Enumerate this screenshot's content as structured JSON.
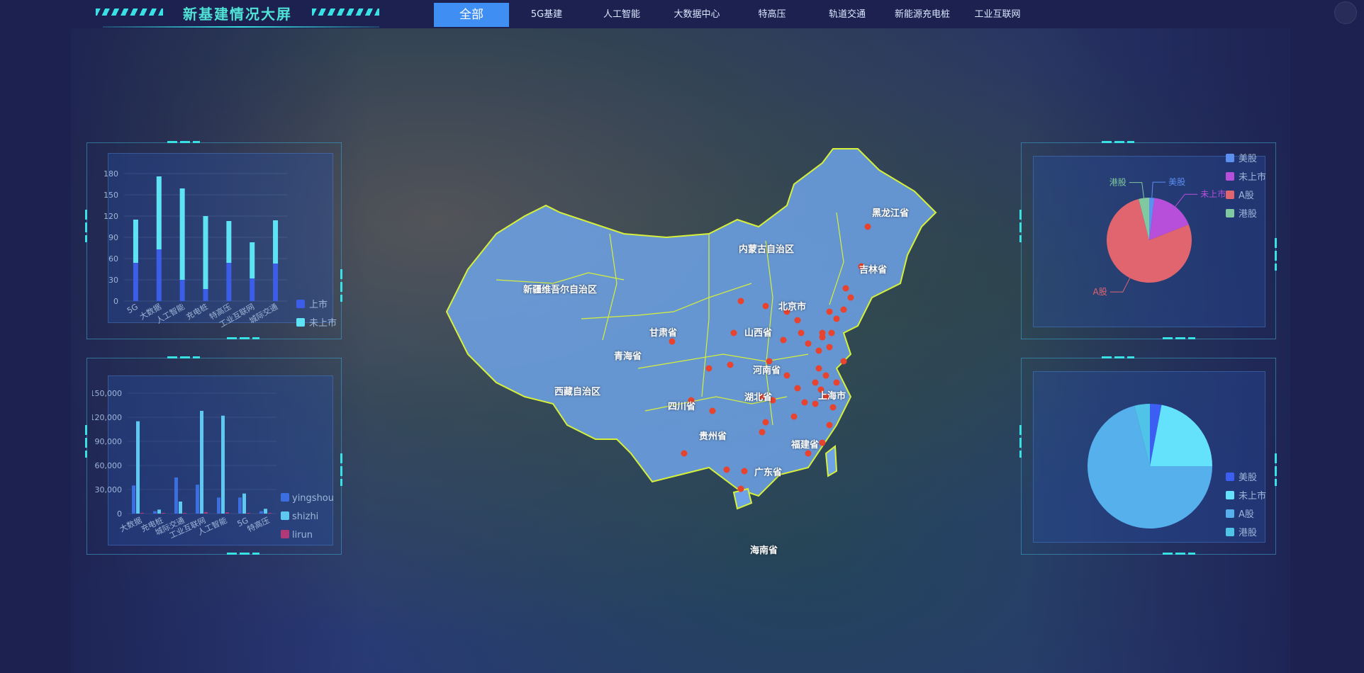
{
  "header": {
    "title": "新基建情况大屏",
    "tabs": [
      "全部",
      "5G基建",
      "人工智能",
      "大数据中心",
      "特高压",
      "轨道交通",
      "新能源充电桩",
      "工业互联网"
    ],
    "active_tab": "全部"
  },
  "map": {
    "provinces": [
      {
        "name": "黑龙江省"
      },
      {
        "name": "内蒙古自治区"
      },
      {
        "name": "吉林省"
      },
      {
        "name": "新疆维吾尔自治区"
      },
      {
        "name": "北京市"
      },
      {
        "name": "甘肃省"
      },
      {
        "name": "山西省"
      },
      {
        "name": "青海省"
      },
      {
        "name": "河南省"
      },
      {
        "name": "西藏自治区"
      },
      {
        "name": "湖北省"
      },
      {
        "name": "上海市"
      },
      {
        "name": "四川省"
      },
      {
        "name": "贵州省"
      },
      {
        "name": "福建省"
      },
      {
        "name": "广东省"
      },
      {
        "name": "海南省"
      }
    ],
    "marker_color": "#e8432e",
    "province_color": "#6ea3e8",
    "border_color": "#d6f03a"
  },
  "chart_data": [
    {
      "id": "listed-by-sector",
      "type": "bar",
      "stacked": true,
      "categories": [
        "5G",
        "大数据",
        "人工智能",
        "充电桩",
        "特高压",
        "工业互联网",
        "城际交通"
      ],
      "series": [
        {
          "name": "上市",
          "values": [
            54,
            73,
            30,
            17,
            54,
            32,
            53
          ],
          "color": "#3b5de7"
        },
        {
          "name": "未上市",
          "values": [
            61,
            103,
            129,
            103,
            59,
            51,
            61
          ],
          "color": "#5ee3f5"
        }
      ],
      "ylim": [
        0,
        180
      ],
      "yticks": [
        "0",
        "30",
        "60",
        "90",
        "120",
        "150",
        "180"
      ],
      "legend": "right"
    },
    {
      "id": "finance-by-sector",
      "type": "bar",
      "categories": [
        "大数据",
        "充电桩",
        "城际交通",
        "工业互联网",
        "人工智能",
        "5G",
        "特高压"
      ],
      "series": [
        {
          "name": "yingshou",
          "values": [
            35000,
            3000,
            45000,
            36000,
            20000,
            20000,
            3000
          ],
          "color": "#3b6fe0"
        },
        {
          "name": "shizhi",
          "values": [
            115000,
            5000,
            15000,
            128000,
            122000,
            25000,
            6000
          ],
          "color": "#5ec8f0"
        },
        {
          "name": "lirun",
          "values": [
            1000,
            300,
            500,
            2000,
            1500,
            600,
            200
          ],
          "color": "#b03a78"
        }
      ],
      "ylim": [
        0,
        150000
      ],
      "yticks": [
        "0",
        "30,000",
        "60,000",
        "90,000",
        "120,000",
        "150,000"
      ],
      "legend": "right"
    },
    {
      "id": "listing-pie-top",
      "type": "pie",
      "slices": [
        {
          "name": "美股",
          "value": 2,
          "color": "#5b8ff0"
        },
        {
          "name": "未上市",
          "value": 17,
          "color": "#b84fdb"
        },
        {
          "name": "A股",
          "value": 77,
          "color": "#e0656f"
        },
        {
          "name": "港股",
          "value": 4,
          "color": "#7fc8a0"
        }
      ],
      "legend": "top-right"
    },
    {
      "id": "listing-pie-bottom",
      "type": "pie",
      "slices": [
        {
          "name": "美股",
          "value": 3,
          "color": "#3c5ef2"
        },
        {
          "name": "未上市",
          "value": 22,
          "color": "#64e1fb"
        },
        {
          "name": "A股",
          "value": 71,
          "color": "#56b0ec"
        },
        {
          "name": "港股",
          "value": 4,
          "color": "#4fc3e8"
        }
      ],
      "legend": "bottom-right"
    }
  ]
}
